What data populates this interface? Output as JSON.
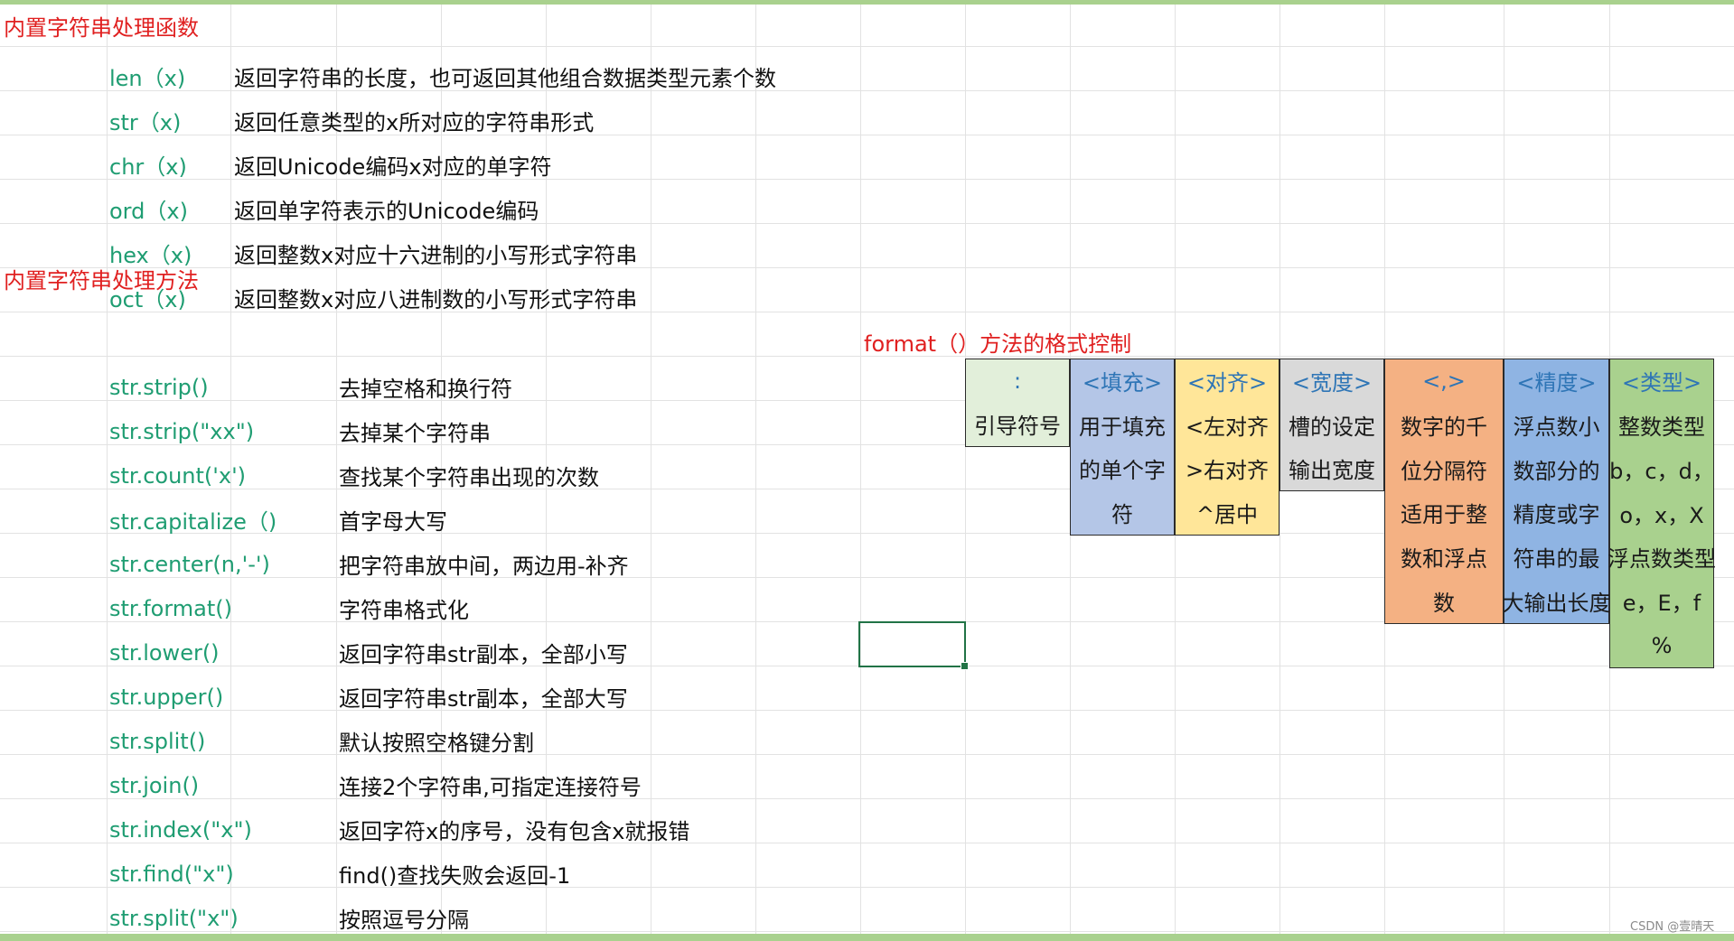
{
  "sections": {
    "functions_title": "内置字符串处理函数",
    "methods_title": "内置字符串处理方法",
    "format_title": "format（）方法的格式控制"
  },
  "functions": [
    {
      "name": "len（x)",
      "desc": "返回字符串的长度，也可返回其他组合数据类型元素个数"
    },
    {
      "name": "str（x)",
      "desc": "返回任意类型的x所对应的字符串形式"
    },
    {
      "name": "chr（x)",
      "desc": "返回Unicode编码x对应的单字符"
    },
    {
      "name": "ord（x)",
      "desc": "返回单字符表示的Unicode编码"
    },
    {
      "name": "hex（x)",
      "desc": "返回整数x对应十六进制的小写形式字符串"
    },
    {
      "name": "oct（x)",
      "desc": "返回整数x对应八进制数的小写形式字符串"
    }
  ],
  "methods": [
    {
      "name": "str.strip()",
      "desc": "去掉空格和换行符"
    },
    {
      "name": "str.strip(\"xx\")",
      "desc": "去掉某个字符串"
    },
    {
      "name": "str.count('x')",
      "desc": "查找某个字符串出现的次数"
    },
    {
      "name": "str.capitalize（)",
      "desc": "首字母大写"
    },
    {
      "name": "str.center(n,'-')",
      "desc": "把字符串放中间，两边用-补齐"
    },
    {
      "name": "str.format()",
      "desc": "字符串格式化"
    },
    {
      "name": "str.lower()",
      "desc": "返回字符串str副本，全部小写"
    },
    {
      "name": "str.upper()",
      "desc": "返回字符串str副本，全部大写"
    },
    {
      "name": "str.split()",
      "desc": "默认按照空格键分割"
    },
    {
      "name": "str.join()",
      "desc": "连接2个字符串,可指定连接符号"
    },
    {
      "name": "str.index(\"x\")",
      "desc": "返回字符x的序号，没有包含x就报错"
    },
    {
      "name": "str.find(\"x\")",
      "desc": "find()查找失败会返回-1"
    },
    {
      "name": "str.split(\"x\")",
      "desc": "按照逗号分隔"
    }
  ],
  "format_columns": [
    {
      "header": ":",
      "color": "#e2efda",
      "lines": [
        "引导符号"
      ]
    },
    {
      "header": "<填充>",
      "color": "#b4c6e7",
      "lines": [
        "用于填充",
        "的单个字",
        "符"
      ]
    },
    {
      "header": "<对齐>",
      "color": "#ffe699",
      "lines": [
        "<左对齐",
        ">右对齐",
        "^居中"
      ]
    },
    {
      "header": "<宽度>",
      "color": "#d9d9d9",
      "lines": [
        "槽的设定",
        "输出宽度"
      ]
    },
    {
      "header": "<,>",
      "color": "#f4b183",
      "lines": [
        "数字的千",
        "位分隔符",
        "适用于整",
        "数和浮点",
        "数"
      ]
    },
    {
      "header": "<精度>",
      "color": "#8fb4e3",
      "lines": [
        "浮点数小",
        "数部分的",
        "精度或字",
        "符串的最",
        "大输出长度"
      ]
    },
    {
      "header": "<类型>",
      "color": "#a9d18e",
      "lines": [
        "整数类型",
        "b，c，d，",
        "o，x，X",
        "浮点数类型",
        "e，E，f",
        "%"
      ]
    }
  ],
  "watermark": "CSDN @壹晴天",
  "colors": {
    "section_title": "#e02020",
    "func_name": "#1f9d72",
    "format_header_text": "#2e75b6",
    "selection": "#217346",
    "frame": "#a9d18e"
  }
}
